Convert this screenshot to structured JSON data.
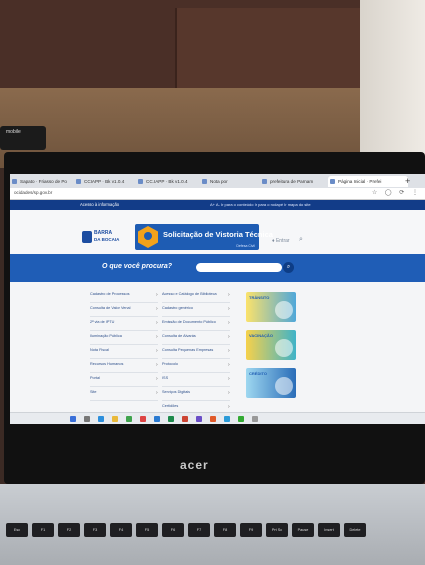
{
  "phone": {
    "logo": "mobile"
  },
  "browser": {
    "tabs": [
      {
        "label": "Sapato · Friasso de Po",
        "active": false
      },
      {
        "label": "CCIAPP · Bk v1.0.4",
        "active": false
      },
      {
        "label": "CC.IAPP · Bk v1.0.4",
        "active": false
      },
      {
        "label": "Nota por",
        "active": false
      },
      {
        "label": "prefeitura de Parnam",
        "active": false
      },
      {
        "label": "Página Inicial · Prefei",
        "active": true
      }
    ],
    "new_tab": "+",
    "url": "ocidades/sp.gov.br",
    "address_icons": "☆ ◯ ⟳ ⋮"
  },
  "gov_bar": {
    "left": "Acesso à informação",
    "right": "A+  A-  Ir para o conteúdo  Ir para o rodapé  Ir mapa do site"
  },
  "header": {
    "logo_line1": "BARRA",
    "logo_line2": "DA BOCAIA",
    "banner_title": "Solicitação de Vistoria Técnica",
    "banner_sub": "Defesa Civil",
    "header_icons": "♦ Entrar",
    "search_icon": "⌕"
  },
  "search": {
    "label": "O que você procura?",
    "placeholder": "",
    "button": "⌕"
  },
  "columns": {
    "left": [
      "Cadastro de Processos",
      "Consulta de Valor Venal",
      "2ª via de IPTU",
      "Iluminação Pública",
      "Nota Fiscal",
      "Recursos Humanos",
      "Portal",
      "Site"
    ],
    "mid": [
      "Acesso e Catálogo de Biblioteca",
      "Cadastro genérico",
      "Emissão de Documento Público",
      "Consulta de Alvarás",
      "Consulta Pequenas Empresas",
      "Protocolo",
      "ISS",
      "Serviços Digitais",
      "Certidões"
    ],
    "arrow": "›"
  },
  "cards": [
    "TRÂNSITO",
    "VACINAÇÃO",
    "CRÉDITO"
  ],
  "brand": "acer",
  "keys": [
    "Esc",
    "F1",
    "F2",
    "F3",
    "F4",
    "F5",
    "F6",
    "F7",
    "F8",
    "F9",
    "Prt Sc",
    "Pause",
    "Insert",
    "Delete"
  ]
}
